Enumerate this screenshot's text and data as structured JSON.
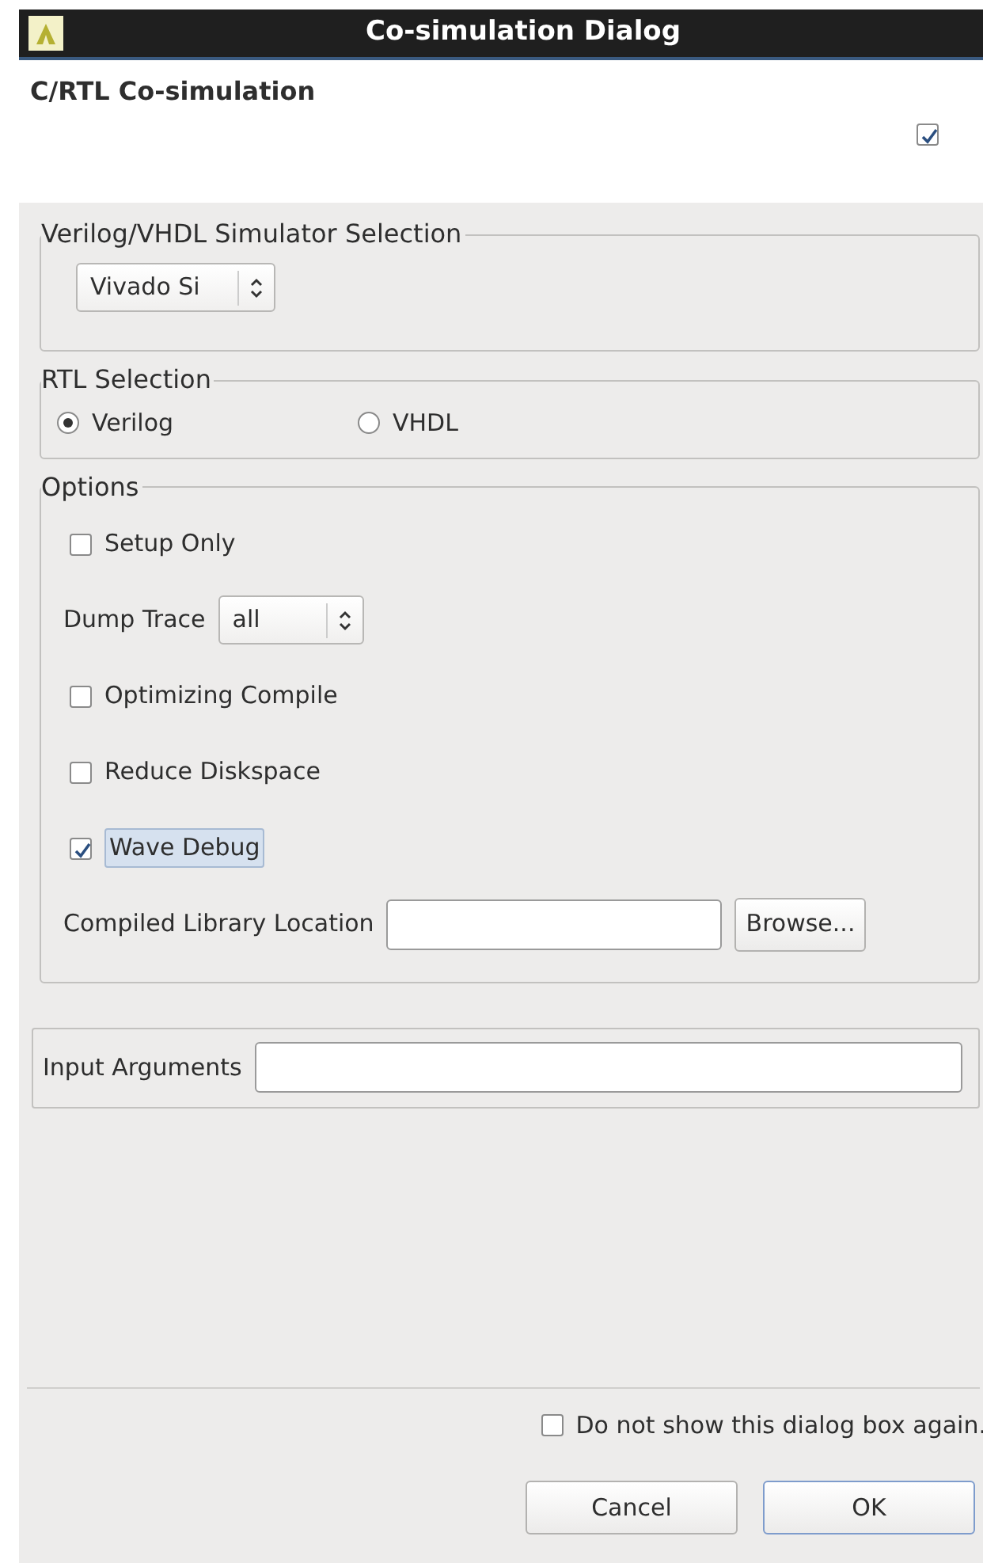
{
  "window": {
    "title": "Co-simulation Dialog"
  },
  "header": {
    "title": "C/RTL Co-simulation",
    "checked": true
  },
  "simulator_group": {
    "legend": "Verilog/VHDL Simulator Selection",
    "value": "Vivado Si"
  },
  "rtl_group": {
    "legend": "RTL Selection",
    "options": [
      {
        "label": "Verilog",
        "selected": true
      },
      {
        "label": "VHDL",
        "selected": false
      }
    ]
  },
  "options_group": {
    "legend": "Options",
    "items": [
      {
        "kind": "checkbox",
        "label": "Setup Only",
        "checked": false
      },
      {
        "kind": "select",
        "label": "Dump Trace",
        "value": "all"
      },
      {
        "kind": "checkbox",
        "label": "Optimizing Compile",
        "checked": false
      },
      {
        "kind": "checkbox",
        "label": "Reduce Diskspace",
        "checked": false
      },
      {
        "kind": "checkbox",
        "label": "Wave Debug",
        "checked": true,
        "focused": true
      },
      {
        "kind": "path",
        "label": "Compiled Library Location",
        "button": "Browse..."
      }
    ]
  },
  "input_arguments": {
    "label": "Input Arguments"
  },
  "dont_show": {
    "label": "Do not show this dialog box again.",
    "checked": false
  },
  "buttons": [
    {
      "label": "Cancel",
      "default": false
    },
    {
      "label": "OK",
      "default": true
    }
  ]
}
